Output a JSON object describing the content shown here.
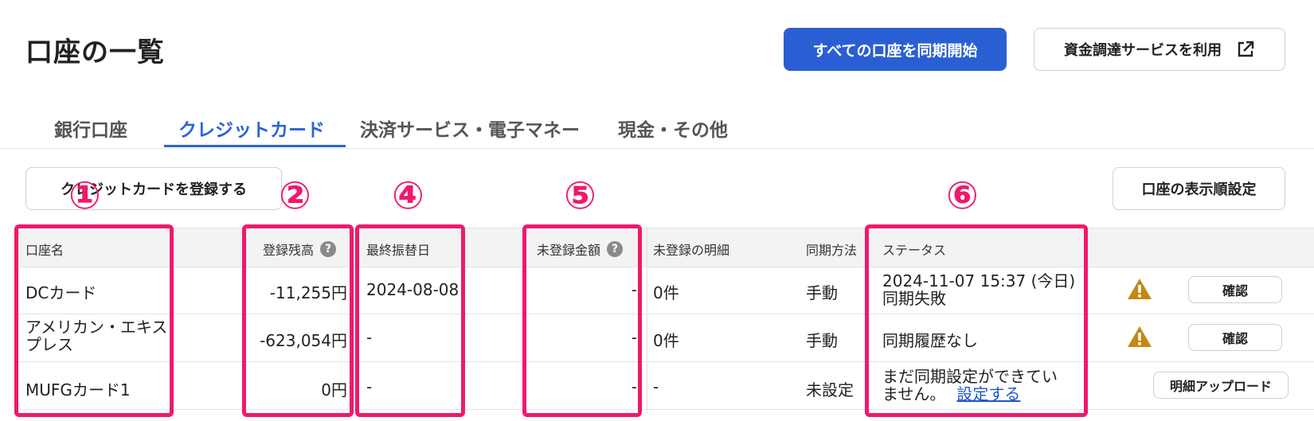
{
  "header": {
    "title": "口座の一覧",
    "sync_all_label": "すべての口座を同期開始",
    "funding_label": "資金調達サービスを利用"
  },
  "tabs": [
    {
      "label": "銀行口座",
      "active": false
    },
    {
      "label": "クレジットカード",
      "active": true
    },
    {
      "label": "決済サービス・電子マネー",
      "active": false
    },
    {
      "label": "現金・その他",
      "active": false
    }
  ],
  "toolbar": {
    "register_label": "クレジットカードを登録する",
    "order_label": "口座の表示順設定"
  },
  "table": {
    "columns": {
      "name": "口座名",
      "balance": "登録残高",
      "last_transfer": "最終振替日",
      "unregistered_amount": "未登録金額",
      "unregistered_details": "未登録の明細",
      "sync_method": "同期方法",
      "status": "ステータス"
    },
    "rows": [
      {
        "name": "DCカード",
        "balance": "-11,255円",
        "last_transfer": "2024-08-08",
        "unregistered_amount": "-",
        "unregistered_details": "0件",
        "sync_method": "手動",
        "status_line1": "2024-11-07 15:37 (今日)",
        "status_line2": "同期失敗",
        "action": "確認"
      },
      {
        "name": "アメリカン・エキスプレス",
        "balance": "-623,054円",
        "last_transfer": "-",
        "unregistered_amount": "-",
        "unregistered_details": "0件",
        "sync_method": "手動",
        "status_line1": "同期履歴なし",
        "action": "確認"
      },
      {
        "name": "MUFGカード1",
        "balance": "0円",
        "last_transfer": "-",
        "unregistered_amount": "-",
        "unregistered_details": "-",
        "sync_method": "未設定",
        "status_line1": "まだ同期設定ができてい",
        "status_line2": "ません。",
        "status_link": "設定する",
        "action": "明細アップロード"
      }
    ]
  },
  "annotations": {
    "badges": [
      "①",
      "②",
      "④",
      "⑤",
      "⑥"
    ],
    "color": "#f0186c"
  },
  "colors": {
    "primary": "#2a5fd3",
    "tab_active": "#2a64d8",
    "warning": "#c28a14"
  }
}
